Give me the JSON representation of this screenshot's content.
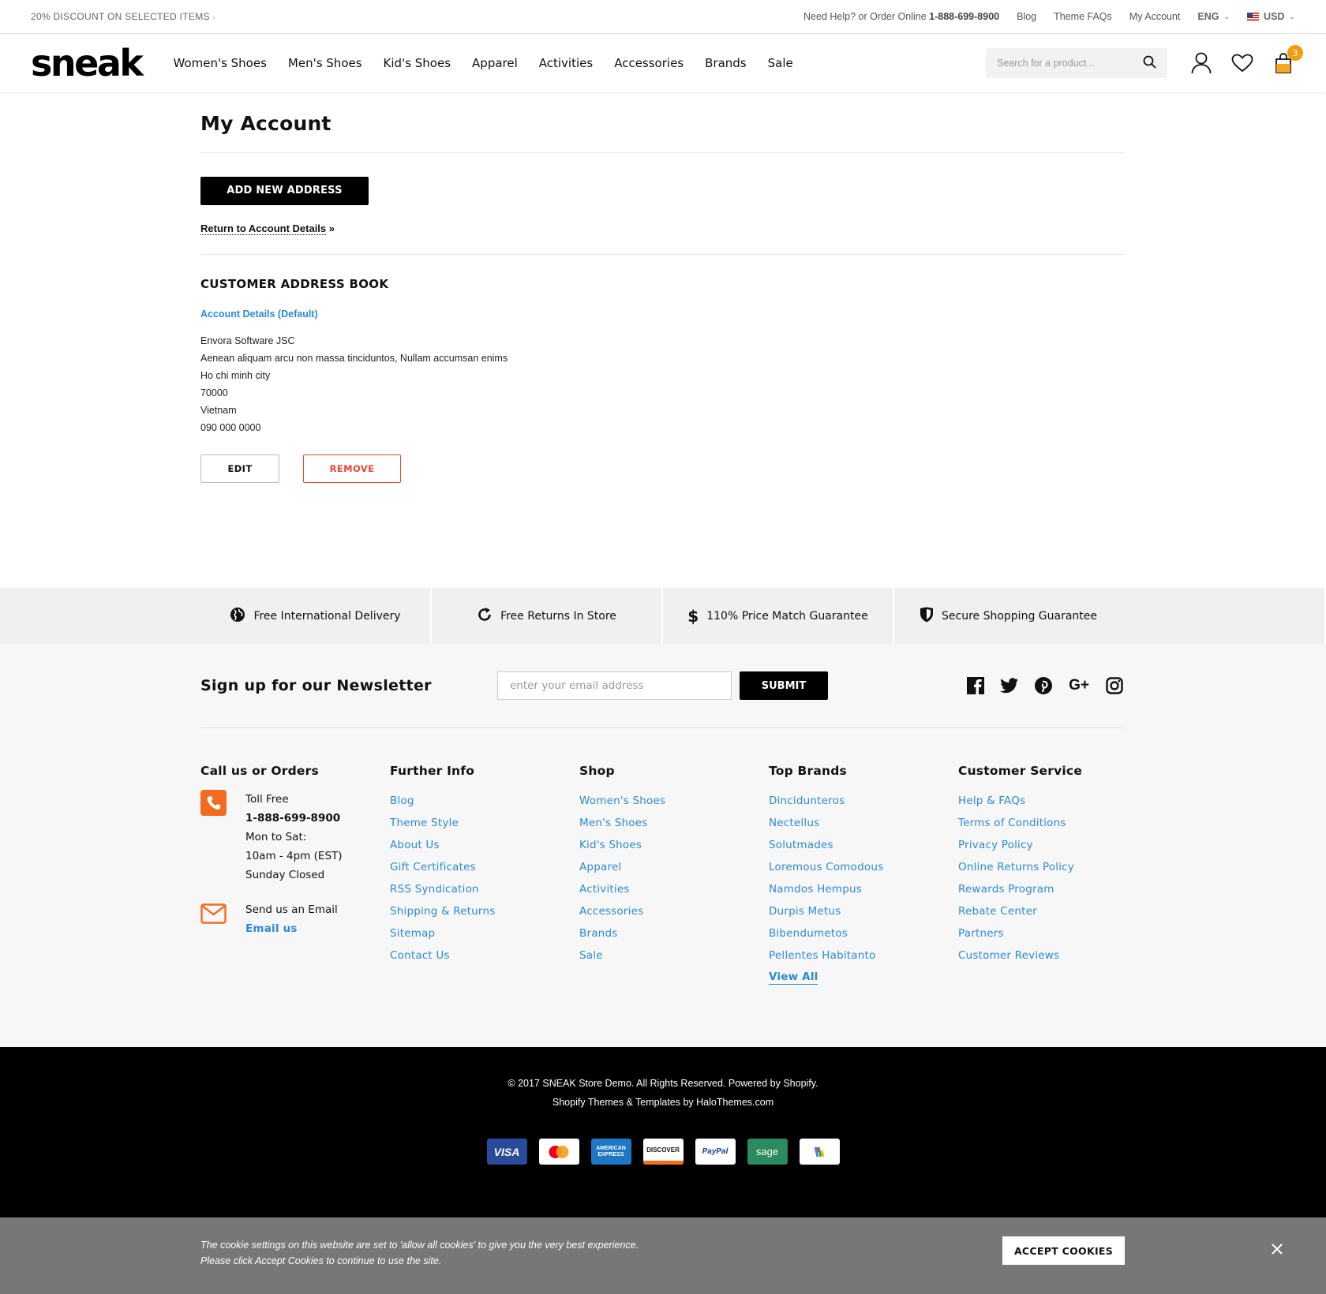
{
  "topbar": {
    "promo": "20% DISCOUNT ON SELECTED ITEMS",
    "help_text": "Need Help? or Order Online",
    "phone": "1-888-699-8900",
    "links": [
      "Blog",
      "Theme FAQs",
      "My Account"
    ],
    "language": "ENG",
    "currency": "USD"
  },
  "header": {
    "logo": "sneak",
    "nav": [
      "Women's Shoes",
      "Men's Shoes",
      "Kid's Shoes",
      "Apparel",
      "Activities",
      "Accessories",
      "Brands",
      "Sale"
    ],
    "search_placeholder": "Search for a product...",
    "cart_count": "3"
  },
  "account": {
    "title": "My Account",
    "add_button": "ADD NEW ADDRESS",
    "return_link": "Return to Account Details",
    "return_suffix": " »",
    "section_title": "CUSTOMER ADDRESS BOOK",
    "default_label": "Account Details (Default)",
    "address_lines": [
      "Envora Software JSC",
      "Aenean aliquam arcu non massa tinciduntos, Nullam accumsan enims",
      "Ho chi minh city",
      "70000",
      "Vietnam",
      "090 000 0000"
    ],
    "edit_button": "EDIT",
    "remove_button": "REMOVE"
  },
  "features": [
    "Free International Delivery",
    "Free Returns In Store",
    "110% Price Match Guarantee",
    "Secure Shopping Guarantee"
  ],
  "newsletter": {
    "title": "Sign up for our Newsletter",
    "placeholder": "enter your email address",
    "submit": "SUBMIT"
  },
  "footer": {
    "call": {
      "title": "Call us or Orders",
      "toll_free": "Toll Free",
      "phone": "1-888-699-8900",
      "hours1": "Mon to Sat:",
      "hours2": "10am - 4pm (EST)",
      "hours3": "Sunday Closed",
      "email_text": "Send us an Email",
      "email_link": "Email us"
    },
    "further_info": {
      "title": "Further Info",
      "links": [
        "Blog",
        "Theme Style",
        "About Us",
        "Gift Certificates",
        "RSS Syndication",
        "Shipping & Returns",
        "Sitemap",
        "Contact Us"
      ]
    },
    "shop": {
      "title": "Shop",
      "links": [
        "Women's Shoes",
        "Men's Shoes",
        "Kid's Shoes",
        "Apparel",
        "Activities",
        "Accessories",
        "Brands",
        "Sale"
      ]
    },
    "top_brands": {
      "title": "Top Brands",
      "links": [
        "Dincidunteros",
        "Nectellus",
        "Solutmades",
        "Loremous Comodous",
        "Namdos Hempus",
        "Durpis Metus",
        "Bibendumetos",
        "Pellentes Habitanto"
      ],
      "view_all": "View All"
    },
    "customer_service": {
      "title": "Customer Service",
      "links": [
        "Help & FAQs",
        "Terms of Conditions",
        "Privacy Policy",
        "Online Returns Policy",
        "Rewards Program",
        "Rebate Center",
        "Partners",
        "Customer Reviews"
      ]
    }
  },
  "bottom": {
    "copyright": "© 2017 SNEAK Store Demo. All Rights Reserved. Powered by Shopify.",
    "credits": "Shopify Themes & Templates by HaloThemes.com",
    "payments": [
      "VISA",
      "MasterCard",
      "AMERICAN EXPRESS",
      "DISCOVER",
      "PayPal",
      "sage",
      "Google"
    ]
  },
  "cookie": {
    "line1": "The cookie settings on this website are set to 'allow all cookies' to give you the very best experience.",
    "line2": "Please click Accept Cookies to continue to use the site.",
    "accept": "ACCEPT COOKIES"
  },
  "colors": {
    "link_blue": "#2d8ad2",
    "accent_orange": "#f36b21",
    "remove_red": "#e43",
    "badge_orange": "#f39c12"
  }
}
